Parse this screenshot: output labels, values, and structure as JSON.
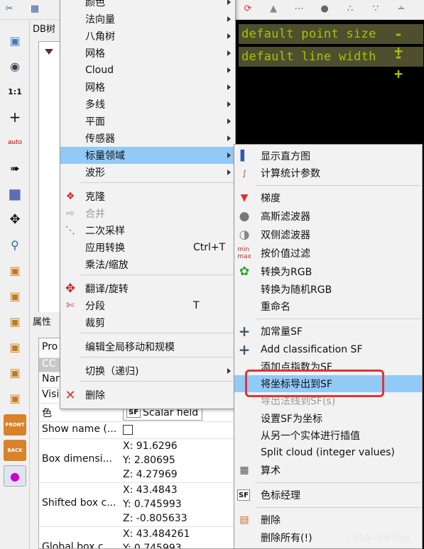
{
  "app": {
    "db_panel_title": "DB树",
    "properties_panel_title": "属性",
    "gl_overlay": [
      "default point size",
      "default line width"
    ],
    "gl_overlay_buttons": "- +"
  },
  "properties": {
    "header": "Pro",
    "rows": [
      {
        "key": "CC",
        "value": ""
      },
      {
        "key": "Nam",
        "value": ""
      },
      {
        "key": "Visi",
        "value": ""
      },
      {
        "key": "色",
        "value": "Scalar field",
        "badge": "SF"
      },
      {
        "key": "Show name (...",
        "value": ""
      },
      {
        "key": "Box dimensi...",
        "value": "X: 91.6296\nY: 2.80695\nZ: 4.27969"
      },
      {
        "key": "Shifted box c...",
        "value": "X: 43.4843\nY: 0.745993\nZ: -0.805633"
      },
      {
        "key": "Global box c...",
        "value": "X: 43.484261\nY: 0.745993"
      }
    ]
  },
  "main_menu": {
    "items": [
      {
        "label": "颜色",
        "submenu": true
      },
      {
        "label": "法向量",
        "submenu": true
      },
      {
        "label": "八角树",
        "submenu": true
      },
      {
        "label": "网格",
        "submenu": true
      },
      {
        "label": "Cloud",
        "submenu": true
      },
      {
        "label": "网格",
        "submenu": true
      },
      {
        "label": "多线",
        "submenu": true
      },
      {
        "label": "平面",
        "submenu": true
      },
      {
        "label": "传感器",
        "submenu": true
      },
      {
        "label": "标量领域",
        "submenu": true,
        "highlight": true
      },
      {
        "label": "波形",
        "submenu": true
      },
      {
        "label": "克隆",
        "icon": "clone-icon"
      },
      {
        "label": "合并",
        "icon": "merge-icon",
        "disabled": true
      },
      {
        "label": "二次采样",
        "icon": "subsample-icon"
      },
      {
        "label": "应用转换",
        "shortcut": "Ctrl+T"
      },
      {
        "label": "乘法/缩放"
      },
      {
        "label": "翻译/旋转",
        "icon": "translate-rotate-icon"
      },
      {
        "label": "分段",
        "icon": "scissors-icon",
        "shortcut": "T"
      },
      {
        "label": "裁剪"
      },
      {
        "label": "编辑全局移动和规模"
      },
      {
        "label": "切换（递归)",
        "submenu": true
      },
      {
        "label": "删除",
        "icon": "delete-x-icon"
      }
    ]
  },
  "sf_submenu": {
    "items": [
      {
        "label": "显示直方图",
        "icon": "histogram-icon"
      },
      {
        "label": "计算统计参数",
        "icon": "statistics-icon"
      },
      {
        "label": "梯度",
        "icon": "gradient-icon"
      },
      {
        "label": "高斯滤波器",
        "icon": "gaussian-filter-icon"
      },
      {
        "label": "双侧滤波器",
        "icon": "bilateral-filter-icon"
      },
      {
        "label": "按价值过滤",
        "icon": "filter-by-value-icon"
      },
      {
        "label": "转换为RGB",
        "icon": "rgb-icon"
      },
      {
        "label": "转换为随机RGB"
      },
      {
        "label": "重命名"
      },
      {
        "label": "加常量SF",
        "icon": "plus-icon"
      },
      {
        "label": "Add classification SF",
        "icon": "plus-icon"
      },
      {
        "label": "添加点指数为SF"
      },
      {
        "label": "将坐标导出到SF",
        "highlight": true
      },
      {
        "label": "导出法线到SF(s)",
        "disabled": true
      },
      {
        "label": "设置SF为坐标"
      },
      {
        "label": "从另一个实体进行插值"
      },
      {
        "label": "Split cloud (integer values)"
      },
      {
        "label": "算术",
        "icon": "calculator-icon"
      },
      {
        "label": "色标经理",
        "icon": "sf-color-scale-icon"
      },
      {
        "label": "删除",
        "icon": "delete-sf-icon"
      },
      {
        "label": "删除所有(!)"
      }
    ]
  },
  "watermark": "CSDN @秋雨qy",
  "colors": {
    "highlight": "#91c9f7",
    "gl_text": "#9ec700",
    "callout": "#e03434"
  }
}
